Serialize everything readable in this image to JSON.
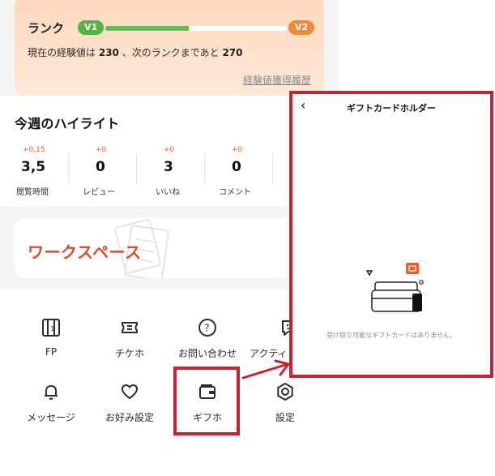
{
  "rank": {
    "title": "ランク",
    "current_level": "V1",
    "next_level": "V2",
    "progress_fraction": 0.46,
    "exp_prefix": "現在の経験値は",
    "exp_current": "230",
    "exp_middle": "、次のランクまであと",
    "exp_remaining": "270",
    "history_link": "経験値獲得履歴"
  },
  "highlights": {
    "title": "今週のハイライト",
    "metrics": [
      {
        "delta": "+0,15",
        "value": "3,5",
        "label": "閲覧時間"
      },
      {
        "delta": "+0",
        "value": "0",
        "label": "レビュー"
      },
      {
        "delta": "+0",
        "value": "3",
        "label": "いいね"
      },
      {
        "delta": "+0",
        "value": "0",
        "label": "コメント"
      }
    ]
  },
  "workspace": {
    "title": "ワークスペース"
  },
  "menu": {
    "items": [
      {
        "id": "fp",
        "label": "FP",
        "icon": "fp-card-icon"
      },
      {
        "id": "ticket",
        "label": "チケホ",
        "icon": "ticket-icon"
      },
      {
        "id": "help",
        "label": "お問い合わせ",
        "icon": "help-circle-icon"
      },
      {
        "id": "activity",
        "label": "アクティ",
        "icon": "chat-smile-icon"
      },
      {
        "id": "messages",
        "label": "メッセージ",
        "icon": "bell-icon"
      },
      {
        "id": "favorites",
        "label": "お好み設定",
        "icon": "heart-icon"
      },
      {
        "id": "gift",
        "label": "ギフホ",
        "icon": "wallet-icon"
      },
      {
        "id": "settings",
        "label": "設定",
        "icon": "settings-hex-icon"
      }
    ]
  },
  "gift_panel": {
    "title": "ギフトカードホルダー",
    "back_label": "‹",
    "empty_message": "受け取り可能なギフトカードはありません。"
  },
  "colors": {
    "highlight_red": "#cc1f2f",
    "accent_orange": "#e24a2b",
    "rank_bg": "#ffd7bd",
    "progress_green": "#5dbf55"
  }
}
